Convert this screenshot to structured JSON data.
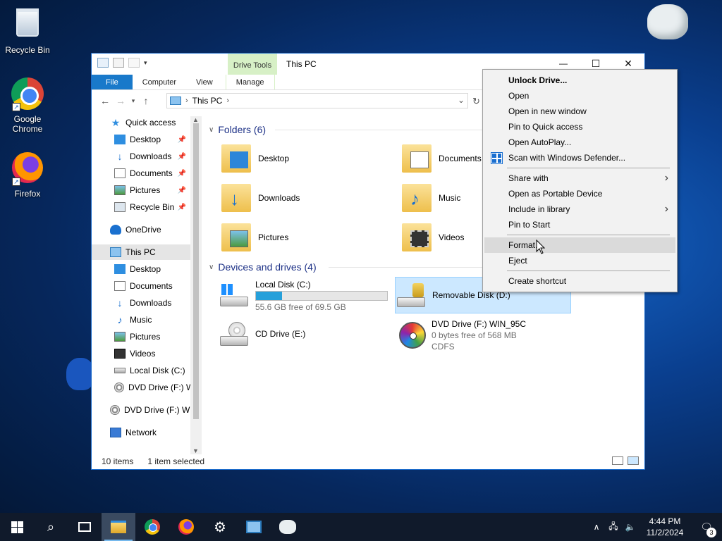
{
  "desktop": {
    "icons": [
      {
        "label": "Recycle Bin",
        "icon": "recycle-bin-icon"
      },
      {
        "label": "Google Chrome",
        "icon": "chrome-icon"
      },
      {
        "label": "Firefox",
        "icon": "firefox-icon"
      }
    ]
  },
  "window": {
    "title": "This PC",
    "context_tab_group": "Drive Tools",
    "tabs": [
      "File",
      "Computer",
      "View",
      "Manage"
    ],
    "controls": {
      "minimize": "—",
      "maximize": "☐",
      "close": "✕"
    },
    "address": {
      "root_icon": "pc-icon",
      "path": "This PC"
    }
  },
  "nav_pane": {
    "items": [
      {
        "label": "Quick access",
        "icon": "star-icon",
        "pinned": false
      },
      {
        "label": "Desktop",
        "icon": "desktop-icon",
        "pinned": true
      },
      {
        "label": "Downloads",
        "icon": "downloads-icon",
        "pinned": true
      },
      {
        "label": "Documents",
        "icon": "documents-icon",
        "pinned": true
      },
      {
        "label": "Pictures",
        "icon": "pictures-icon",
        "pinned": true
      },
      {
        "label": "Recycle Bin",
        "icon": "recycle-bin-icon",
        "pinned": true
      },
      {
        "label": "OneDrive",
        "icon": "onedrive-icon",
        "pinned": false
      },
      {
        "label": "This PC",
        "icon": "pc-icon",
        "pinned": false,
        "selected": true
      },
      {
        "label": "Desktop",
        "icon": "desktop-icon"
      },
      {
        "label": "Documents",
        "icon": "documents-icon"
      },
      {
        "label": "Downloads",
        "icon": "downloads-icon"
      },
      {
        "label": "Music",
        "icon": "music-icon"
      },
      {
        "label": "Pictures",
        "icon": "pictures-icon"
      },
      {
        "label": "Videos",
        "icon": "videos-icon"
      },
      {
        "label": "Local Disk (C:)",
        "icon": "local-disk-icon"
      },
      {
        "label": "DVD Drive (F:) W",
        "icon": "dvd-icon"
      },
      {
        "label": "DVD Drive (F:) WIN",
        "icon": "dvd-icon"
      },
      {
        "label": "Network",
        "icon": "network-icon"
      }
    ]
  },
  "content": {
    "folders_header": "Folders (6)",
    "folders": [
      {
        "label": "Desktop",
        "icon": "desktop-folder-icon"
      },
      {
        "label": "Documents",
        "icon": "documents-folder-icon"
      },
      {
        "label": "Downloads",
        "icon": "downloads-folder-icon"
      },
      {
        "label": "Music",
        "icon": "music-folder-icon"
      },
      {
        "label": "Pictures",
        "icon": "pictures-folder-icon"
      },
      {
        "label": "Videos",
        "icon": "videos-folder-icon"
      }
    ],
    "devices_header": "Devices and drives (4)",
    "drives": [
      {
        "name": "Local Disk (C:)",
        "free": "55.6 GB free of 69.5 GB",
        "used_fraction": 0.2,
        "icon": "local-disk-icon"
      },
      {
        "name": "Removable Disk (D:)",
        "icon": "removable-disk-locked-icon",
        "selected": true
      },
      {
        "name": "CD Drive (E:)",
        "icon": "cd-drive-icon"
      },
      {
        "name": "DVD Drive (F:) WIN_95C",
        "free": "0 bytes free of 568 MB",
        "fs": "CDFS",
        "icon": "dvd-drive-icon"
      }
    ]
  },
  "status": {
    "items": "10 items",
    "selected": "1 item selected"
  },
  "context_menu": {
    "items": [
      {
        "label": "Unlock Drive...",
        "bold": true
      },
      {
        "label": "Open"
      },
      {
        "label": "Open in new window"
      },
      {
        "label": "Pin to Quick access"
      },
      {
        "label": "Open AutoPlay..."
      },
      {
        "label": "Scan with Windows Defender...",
        "icon": "defender-icon"
      },
      {
        "label": "Share with",
        "submenu": true
      },
      {
        "label": "Open as Portable Device"
      },
      {
        "label": "Include in library",
        "submenu": true
      },
      {
        "label": "Pin to Start"
      },
      {
        "label": "Format...",
        "hover": true
      },
      {
        "label": "Eject"
      },
      {
        "label": "Create shortcut"
      }
    ],
    "submenu_glyph": "›"
  },
  "taskbar": {
    "clock_time": "4:44 PM",
    "clock_date": "11/2/2024",
    "notification_count": "3",
    "apps": [
      "start-icon",
      "search-icon",
      "task-view-icon",
      "file-explorer-icon",
      "chrome-icon",
      "firefox-icon",
      "settings-icon",
      "app-icon",
      "bear-app-icon"
    ]
  }
}
